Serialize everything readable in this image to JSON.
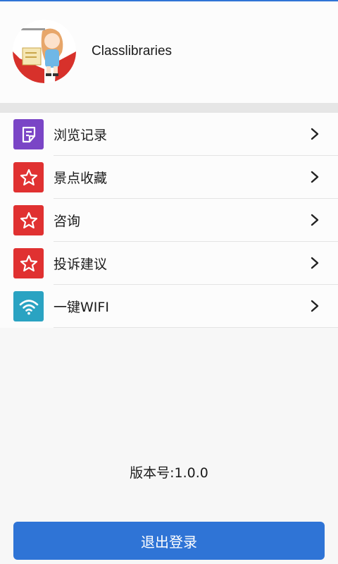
{
  "profile": {
    "username": "Classlibraries"
  },
  "menu": {
    "items": [
      {
        "label": "浏览记录",
        "icon": "document-icon",
        "color": "#7a45c6"
      },
      {
        "label": "景点收藏",
        "icon": "star-icon",
        "color": "#e03131"
      },
      {
        "label": "咨询",
        "icon": "star-icon",
        "color": "#e03131"
      },
      {
        "label": "投诉建议",
        "icon": "star-icon",
        "color": "#e03131"
      },
      {
        "label": "一键WIFI",
        "icon": "wifi-icon",
        "color": "#2aa3c2"
      }
    ]
  },
  "footer": {
    "version": "版本号:1.0.0",
    "logout_label": "退出登录"
  },
  "colors": {
    "accent": "#2f74d6",
    "background": "#f7f7f7"
  }
}
